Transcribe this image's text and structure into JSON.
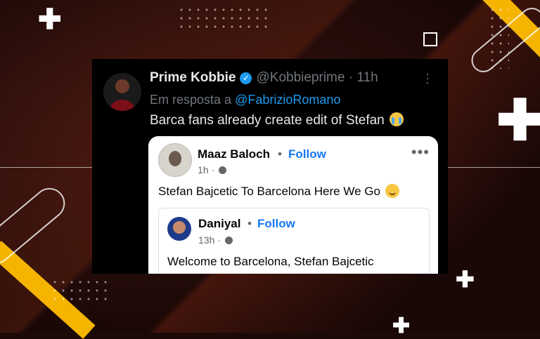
{
  "tweet": {
    "author_name": "Prime Kobbie",
    "handle": "@Kobbieprime",
    "separator": "·",
    "time": "11h",
    "reply_prefix": "Em resposta a",
    "reply_mention": "@FabrizioRomano",
    "text": "Barca fans already create edit of Stefan",
    "more_icon": "vertical-dots-icon"
  },
  "fb_post": {
    "author": "Maaz Baloch",
    "separator": "•",
    "follow_label": "Follow",
    "time": "1h",
    "time_separator": "·",
    "text": "Stefan Bajcetic To Barcelona Here We Go",
    "more_icon": "horizontal-dots-icon"
  },
  "fb_shared_post": {
    "author": "Daniyal",
    "separator": "•",
    "follow_label": "Follow",
    "time": "13h",
    "time_separator": "·",
    "text": "Welcome to Barcelona, Stefan Bajcetic"
  },
  "colors": {
    "accent_blue": "#1d9bf0",
    "fb_blue": "#1877f2",
    "stripe_yellow": "#f5b400"
  }
}
